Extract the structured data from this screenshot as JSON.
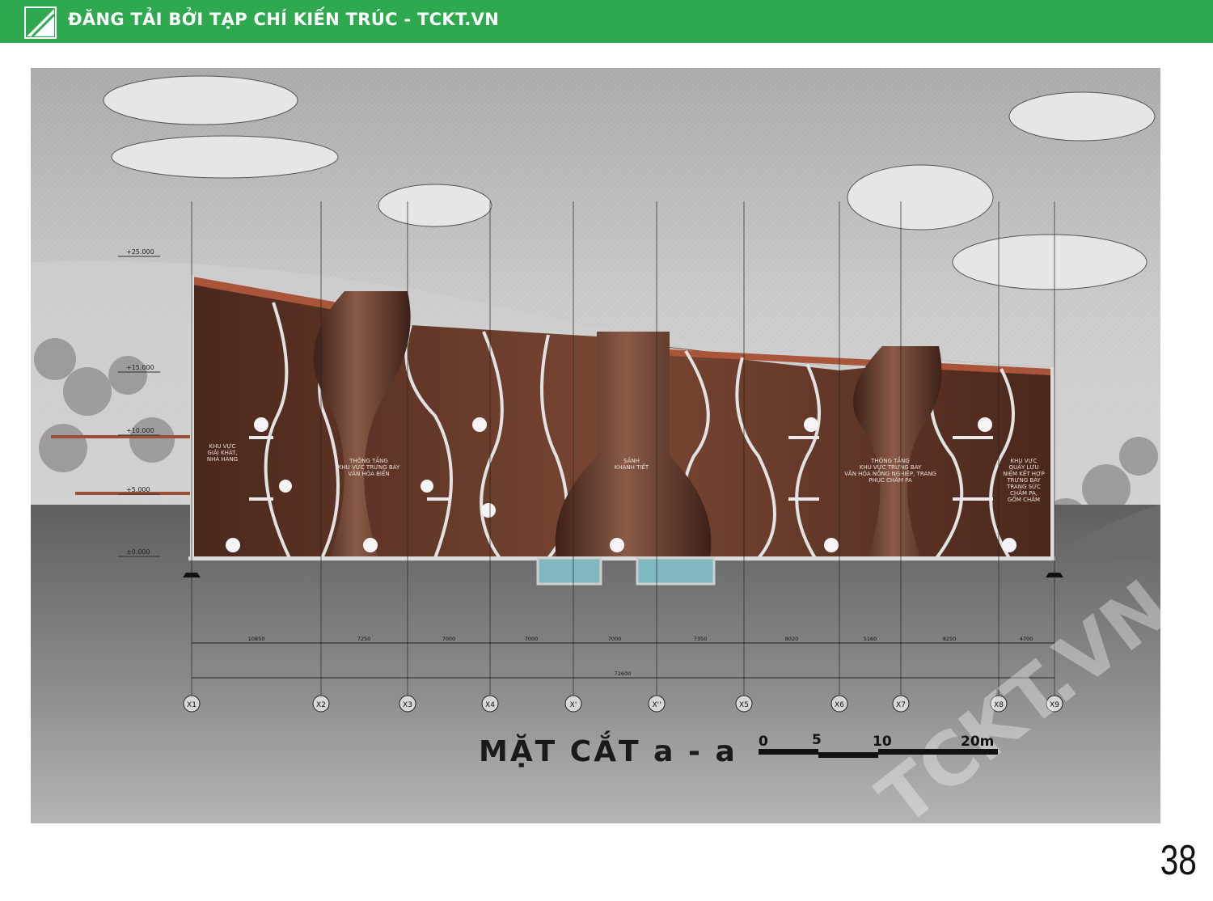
{
  "banner": {
    "text": "ĐĂNG TẢI BỞI TẠP CHÍ KIẾN TRÚC - TCKT.VN",
    "color": "#2ea94f"
  },
  "section": {
    "title": "MẶT CẮT a - a",
    "scale_labels": [
      "0",
      "5",
      "10",
      "20m"
    ],
    "levels": [
      "+25.000",
      "+15.000",
      "+10.000",
      "+5.000",
      "±0.000"
    ],
    "rooms": [
      [
        "KHU VỰC",
        "GIẢI KHÁT,",
        "NHÀ HÀNG"
      ],
      [
        "THÔNG TẦNG",
        "KHU VỰC TRƯNG BÀY",
        "VĂN HÓA BIỂN"
      ],
      [
        "SẢNH",
        "KHÁNH TIẾT"
      ],
      [
        "THÔNG TẦNG",
        "KHU VỰC TRƯNG BÀY",
        "VĂN HÓA NÔNG NGHIỆP, TRANG",
        "PHỤC CHĂM PA"
      ],
      [
        "KHU VỰC",
        "QUẦY LƯU",
        "NIỆM KẾT HỢP",
        "TRƯNG BÀY",
        "TRANG SỨC",
        "CHĂM PA,",
        "GỐM CHĂM"
      ]
    ],
    "grid_axes": [
      "X1",
      "X2",
      "X3",
      "X4",
      "X'",
      "X''",
      "X5",
      "X6",
      "X7",
      "X8",
      "X9"
    ],
    "span_dimensions": [
      "10850",
      "7250",
      "7000",
      "7000",
      "7000",
      "7350",
      "8020",
      "5160",
      "8250",
      "4700"
    ],
    "total_dimension": "72600",
    "watermark": "TCKT.VN"
  },
  "page_number": "38",
  "colors": {
    "brick": "#6b3d2c",
    "brick_dark": "#3e2219",
    "water": "#7fb8c0",
    "sky": "#b9b9b9",
    "ground": "#7a7a7a"
  }
}
